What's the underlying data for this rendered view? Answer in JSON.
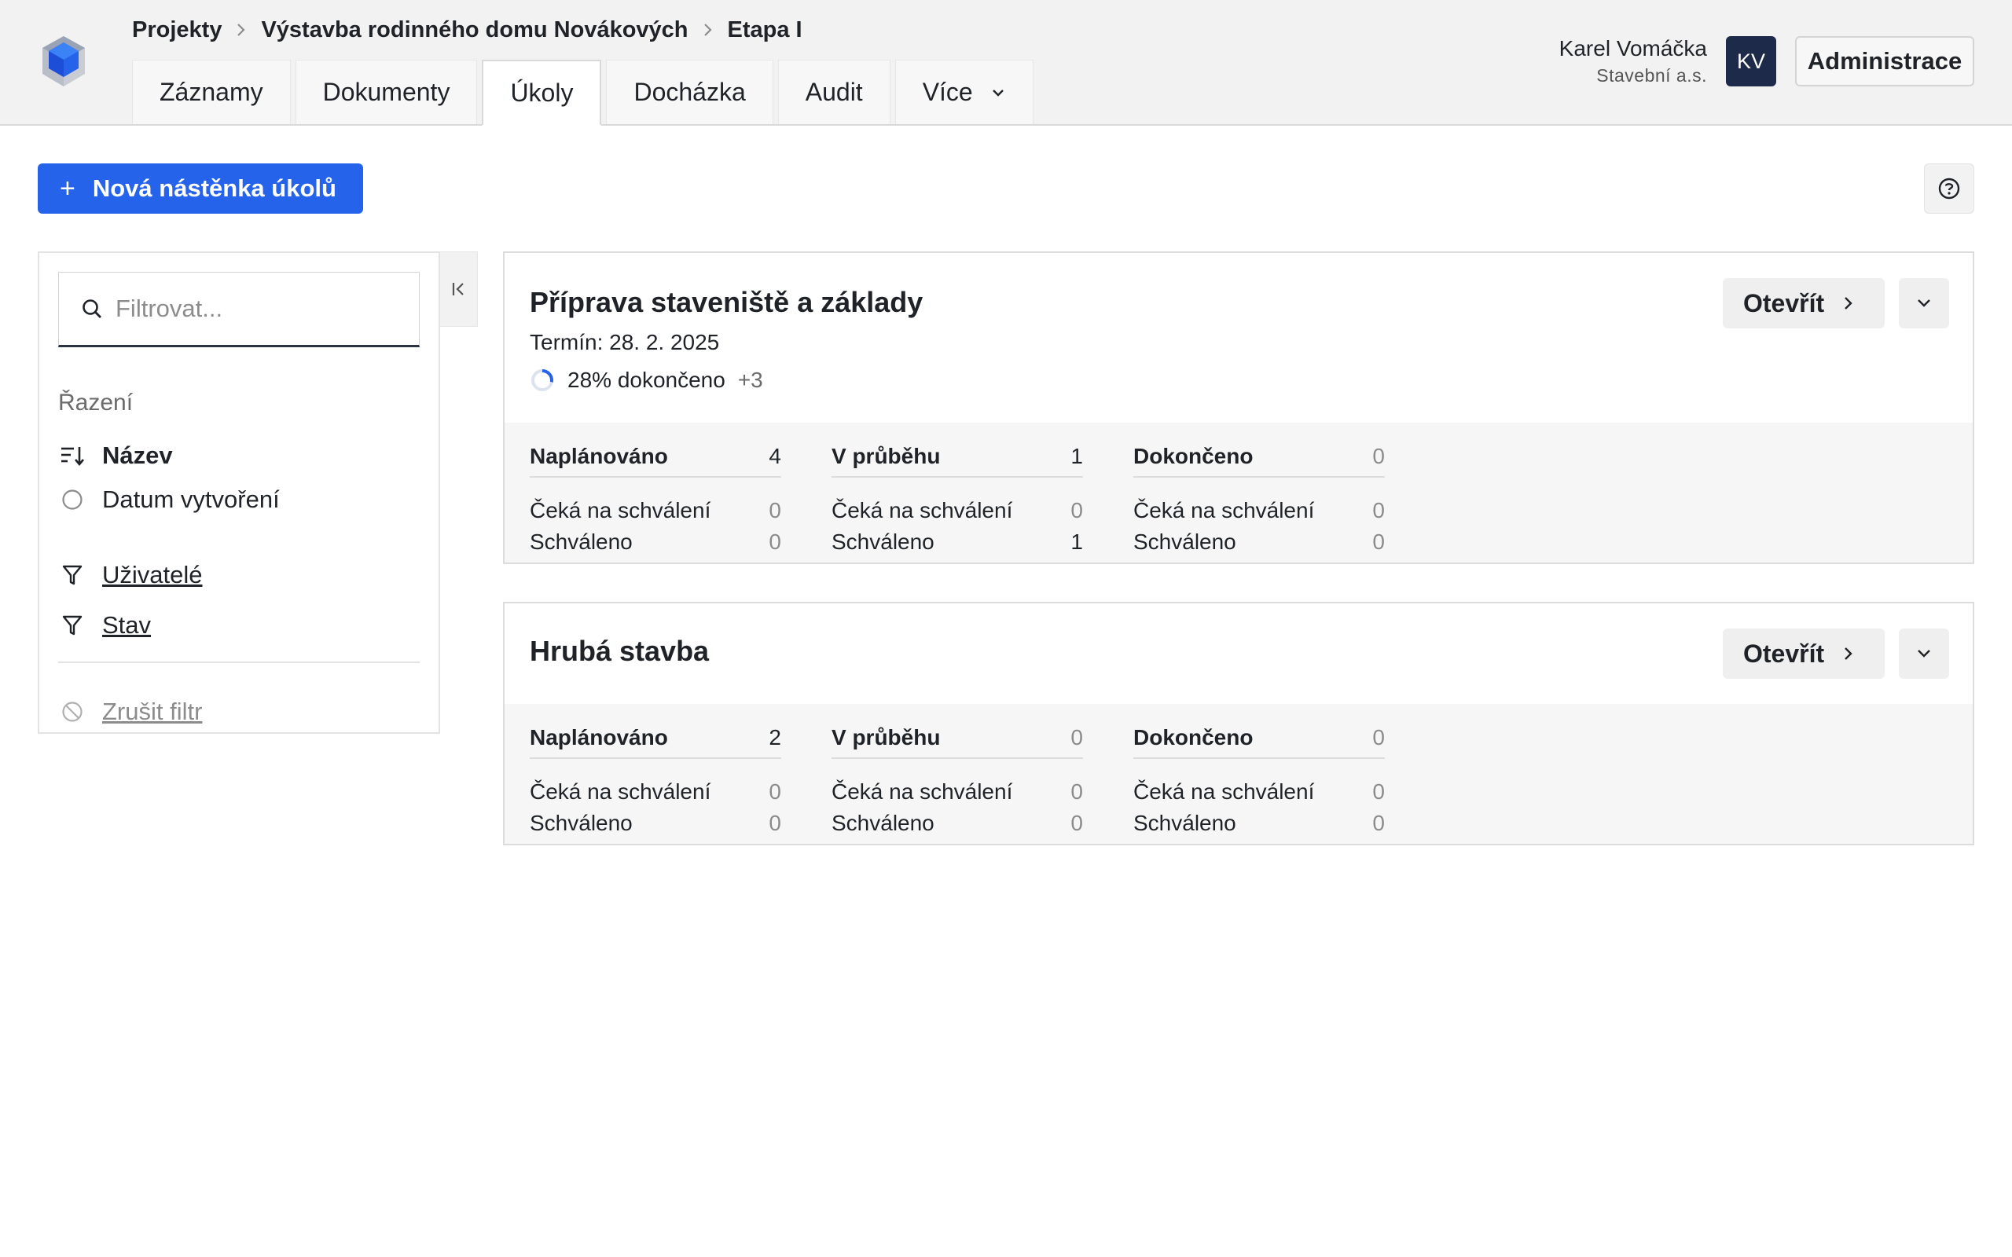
{
  "breadcrumb": [
    "Projekty",
    "Výstavba rodinného domu Novákových",
    "Etapa I"
  ],
  "tabs": [
    {
      "label": "Záznamy",
      "active": false
    },
    {
      "label": "Dokumenty",
      "active": false
    },
    {
      "label": "Úkoly",
      "active": true
    },
    {
      "label": "Docházka",
      "active": false
    },
    {
      "label": "Audit",
      "active": false
    },
    {
      "label": "Více",
      "active": false,
      "dropdown": true
    }
  ],
  "user": {
    "name": "Karel Vomáčka",
    "company": "Stavební a.s.",
    "initials": "KV"
  },
  "admin_label": "Administrace",
  "new_board_label": "Nová nástěnka úkolů",
  "sidebar": {
    "filter_placeholder": "Filtrovat...",
    "sort_title": "Řazení",
    "sort_options": [
      {
        "label": "Název",
        "selected": true,
        "icon": "sort-descending-icon"
      },
      {
        "label": "Datum vytvoření",
        "selected": false,
        "icon": "radio-empty-icon"
      }
    ],
    "filters": [
      {
        "label": "Uživatelé",
        "icon": "funnel-icon"
      },
      {
        "label": "Stav",
        "icon": "funnel-icon"
      }
    ],
    "clear_label": "Zrušit filtr"
  },
  "colors": {
    "accent": "#2563eb",
    "avatar_bg": "#1e2a4a",
    "muted": "#8c8c8c"
  },
  "boards": [
    {
      "title": "Příprava staveniště a základy",
      "deadline": "Termín: 28. 2. 2025",
      "progress_percent": 28,
      "progress_label": "28% dokončeno",
      "extra_count": "+3",
      "open_label": "Otevřít",
      "columns": [
        {
          "name": "Naplánováno",
          "count": "4",
          "waiting_label": "Čeká na schválení",
          "waiting": "0",
          "approved_label": "Schváleno",
          "approved": "0"
        },
        {
          "name": "V průběhu",
          "count": "1",
          "waiting_label": "Čeká na schválení",
          "waiting": "0",
          "approved_label": "Schváleno",
          "approved": "1"
        },
        {
          "name": "Dokončeno",
          "count": "0",
          "waiting_label": "Čeká na schválení",
          "waiting": "0",
          "approved_label": "Schváleno",
          "approved": "0"
        }
      ]
    },
    {
      "title": "Hrubá stavba",
      "open_label": "Otevřít",
      "columns": [
        {
          "name": "Naplánováno",
          "count": "2",
          "waiting_label": "Čeká na schválení",
          "waiting": "0",
          "approved_label": "Schváleno",
          "approved": "0"
        },
        {
          "name": "V průběhu",
          "count": "0",
          "waiting_label": "Čeká na schválení",
          "waiting": "0",
          "approved_label": "Schváleno",
          "approved": "0"
        },
        {
          "name": "Dokončeno",
          "count": "0",
          "waiting_label": "Čeká na schválení",
          "waiting": "0",
          "approved_label": "Schváleno",
          "approved": "0"
        }
      ]
    }
  ]
}
